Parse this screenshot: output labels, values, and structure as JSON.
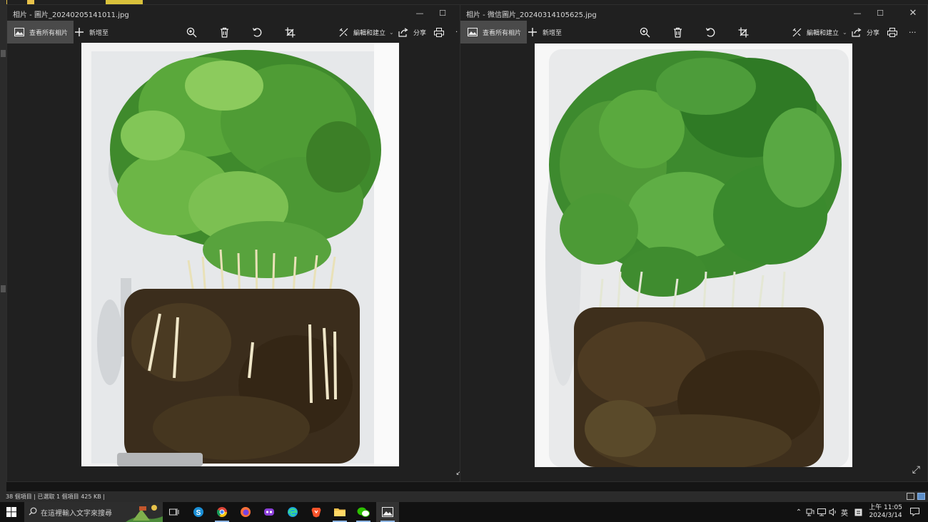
{
  "left_window": {
    "title": "相片 - 圖片_20240205141011.jpg",
    "view_all_label": "查看所有相片",
    "add_to_label": "新增至",
    "edit_create_label": "編輯和建立",
    "share_label": "分享"
  },
  "right_window": {
    "title": "相片 - 微信圖片_20240314105625.jpg",
    "view_all_label": "查看所有相片",
    "add_to_label": "新增至",
    "edit_create_label": "編輯和建立",
    "share_label": "分享",
    "more_label": "···"
  },
  "statusbar": {
    "text": "38 個項目  |  已選取 1 個項目  425 KB  |"
  },
  "taskbar": {
    "search_placeholder": "在這裡輸入文字來搜尋",
    "apps": [
      "task-view",
      "skype",
      "chrome",
      "firefox",
      "game-app",
      "edge",
      "brave",
      "file-explorer",
      "wechat",
      "photos"
    ],
    "ime_label": "英",
    "clock_time": "上午 11:05",
    "clock_date": "2024/3/14"
  },
  "icons": {
    "zoom": "zoom-in-icon",
    "delete": "trash-icon",
    "rotate": "rotate-icon",
    "crop": "crop-icon",
    "edit": "edit-create-icon",
    "share": "share-icon",
    "print": "print-icon",
    "minimize": "minimize-icon",
    "maximize": "maximize-icon",
    "close": "close-icon"
  },
  "colors": {
    "window_bg": "#202020",
    "active_button": "#4a4a4a",
    "taskbar_bg": "#111111",
    "accent": "#8fb7e6"
  }
}
